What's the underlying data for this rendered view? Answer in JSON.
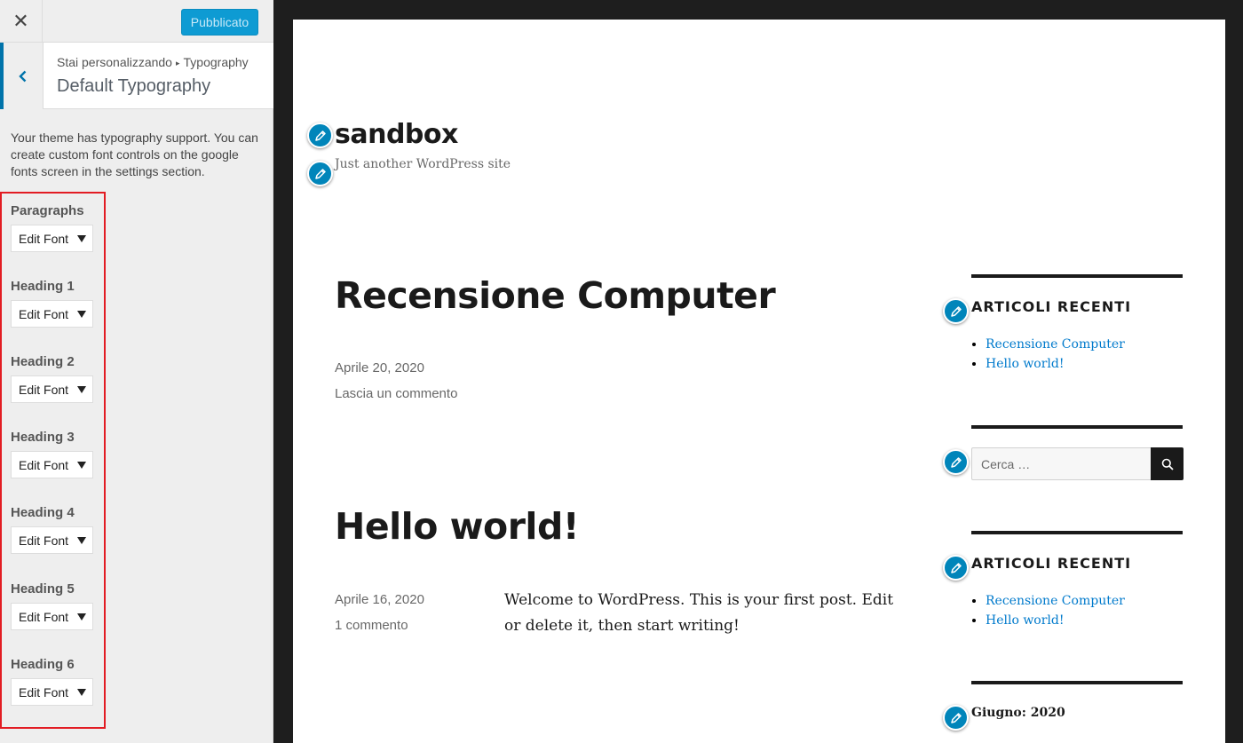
{
  "customizer": {
    "close_icon": "close-icon",
    "publish_label": "Pubblicato",
    "breadcrumb": {
      "prefix": "Stai personalizzando",
      "separator": "▸",
      "panel": "Typography"
    },
    "section_title": "Default Typography",
    "description": "Your theme has typography support. You can create custom font controls on the google fonts screen in the settings section.",
    "controls": [
      {
        "label": "Paragraphs",
        "button": "Edit Font"
      },
      {
        "label": "Heading 1",
        "button": "Edit Font"
      },
      {
        "label": "Heading 2",
        "button": "Edit Font"
      },
      {
        "label": "Heading 3",
        "button": "Edit Font"
      },
      {
        "label": "Heading 4",
        "button": "Edit Font"
      },
      {
        "label": "Heading 5",
        "button": "Edit Font"
      },
      {
        "label": "Heading 6",
        "button": "Edit Font"
      }
    ],
    "colors": {
      "accent": "#0073aa",
      "publish_bg": "#0e9bd3",
      "highlight_border": "#e21c23"
    }
  },
  "preview": {
    "site_title": "sandbox",
    "site_description": "Just another WordPress site",
    "posts": [
      {
        "title": "Recensione Computer",
        "date": "Aprile 20, 2020",
        "comments": "Lascia un commento"
      },
      {
        "title": "Hello world!",
        "date": "Aprile 16, 2020",
        "comments": "1 commento",
        "content": "Welcome to WordPress. This is your first post. Edit or delete it, then start writing!"
      }
    ],
    "widgets": {
      "recent_1": {
        "title": "ARTICOLI RECENTI",
        "items": [
          "Recensione Computer",
          "Hello world!"
        ]
      },
      "search": {
        "placeholder": "Cerca …",
        "icon": "search-icon"
      },
      "recent_2": {
        "title": "ARTICOLI RECENTI",
        "items": [
          "Recensione Computer",
          "Hello world!"
        ]
      },
      "archive_title": "Giugno: 2020"
    },
    "edit_icon": "pencil-icon",
    "link_color": "#007acc"
  }
}
